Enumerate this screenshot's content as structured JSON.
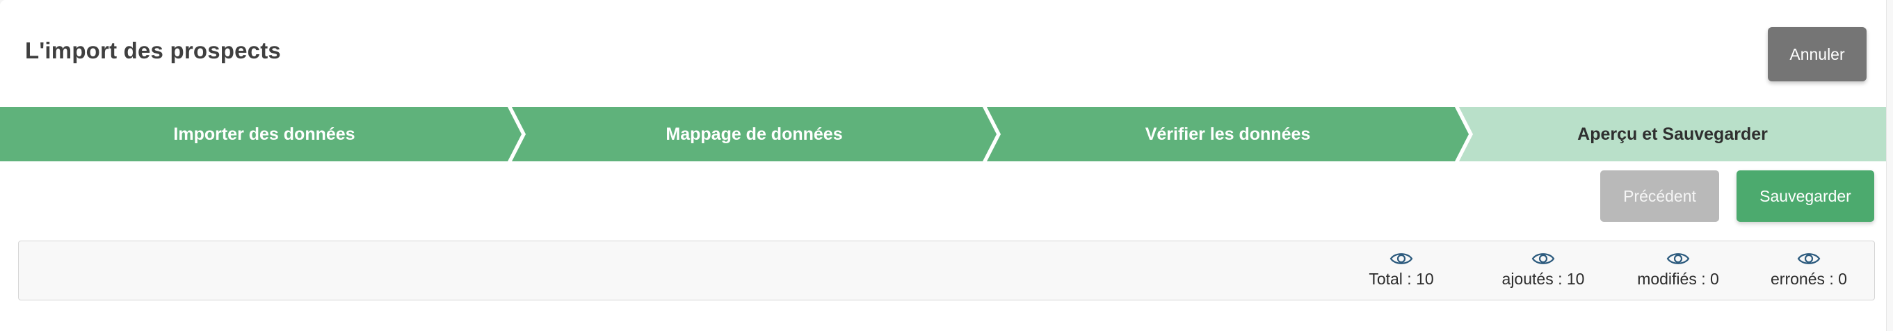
{
  "header": {
    "title": "L'import des prospects",
    "cancel_label": "Annuler"
  },
  "steps": [
    {
      "label": "Importer des données",
      "state": "done"
    },
    {
      "label": "Mappage de données",
      "state": "done"
    },
    {
      "label": "Vérifier les données",
      "state": "done"
    },
    {
      "label": "Aperçu et Sauvegarder",
      "state": "current"
    }
  ],
  "actions": {
    "previous_label": "Précédent",
    "save_label": "Sauvegarder"
  },
  "summary": {
    "total": "Total : 10",
    "added": "ajoutés : 10",
    "modified": "modifiés : 0",
    "errors": "erronés : 0",
    "icon": "eye-icon"
  },
  "colors": {
    "step_done": "#5fb27b",
    "step_current": "#b9e0c9",
    "save_button": "#4caa6e",
    "previous_button": "#b9b9b9",
    "cancel_button": "#757575",
    "eye_icon": "#2d5b7e"
  }
}
